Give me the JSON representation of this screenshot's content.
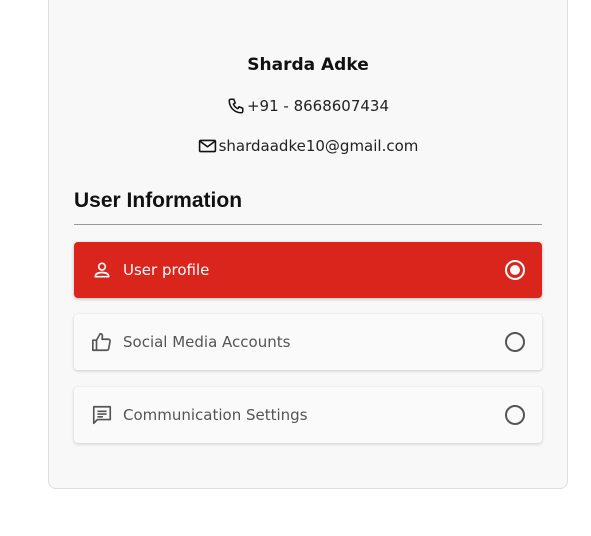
{
  "profile": {
    "name": "Sharda Adke",
    "phone": "+91 - 8668607434",
    "email": "shardaadke10@gmail.com",
    "phone_icon": "phone-icon",
    "email_icon": "mail-icon"
  },
  "section": {
    "title": "User Information"
  },
  "options": [
    {
      "label": "User profile",
      "icon": "person-icon",
      "selected": true
    },
    {
      "label": "Social Media Accounts",
      "icon": "thumbs-up-icon",
      "selected": false
    },
    {
      "label": "Communication Settings",
      "icon": "message-icon",
      "selected": false
    }
  ],
  "colors": {
    "accent": "#da251d",
    "card_bg": "#f8f8f8"
  }
}
